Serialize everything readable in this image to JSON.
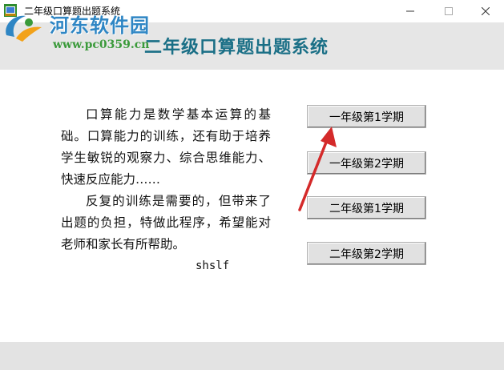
{
  "window": {
    "title": "二年级口算题出题系统",
    "icon": "app-icon",
    "controls": [
      "minimize-icon",
      "maximize-icon",
      "close-icon"
    ]
  },
  "watermark": {
    "name": "河东软件园",
    "url": "www.pc0359.cn"
  },
  "header": {
    "title": "二年级口算题出题系统"
  },
  "intro": {
    "paragraph_1": "口算能力是数学基本运算的基础。口算能力的训练，还有助于培养学生敏锐的观察力、综合思维能力、快速反应能力……",
    "paragraph_2": "反复的训练是需要的，但带来了出题的负担，特做此程序，希望能对老师和家长有所帮助。",
    "signature": "shslf"
  },
  "buttons": [
    {
      "label": "一年级第1学期"
    },
    {
      "label": "一年级第2学期"
    },
    {
      "label": "二年级第1学期"
    },
    {
      "label": "二年级第2学期"
    }
  ],
  "colors": {
    "header_band": "#e6e6e6",
    "title_text": "#1a6f86",
    "arrow": "#d42a2a",
    "watermark_name": "#2f86c4",
    "watermark_url": "#3a9a3a"
  }
}
